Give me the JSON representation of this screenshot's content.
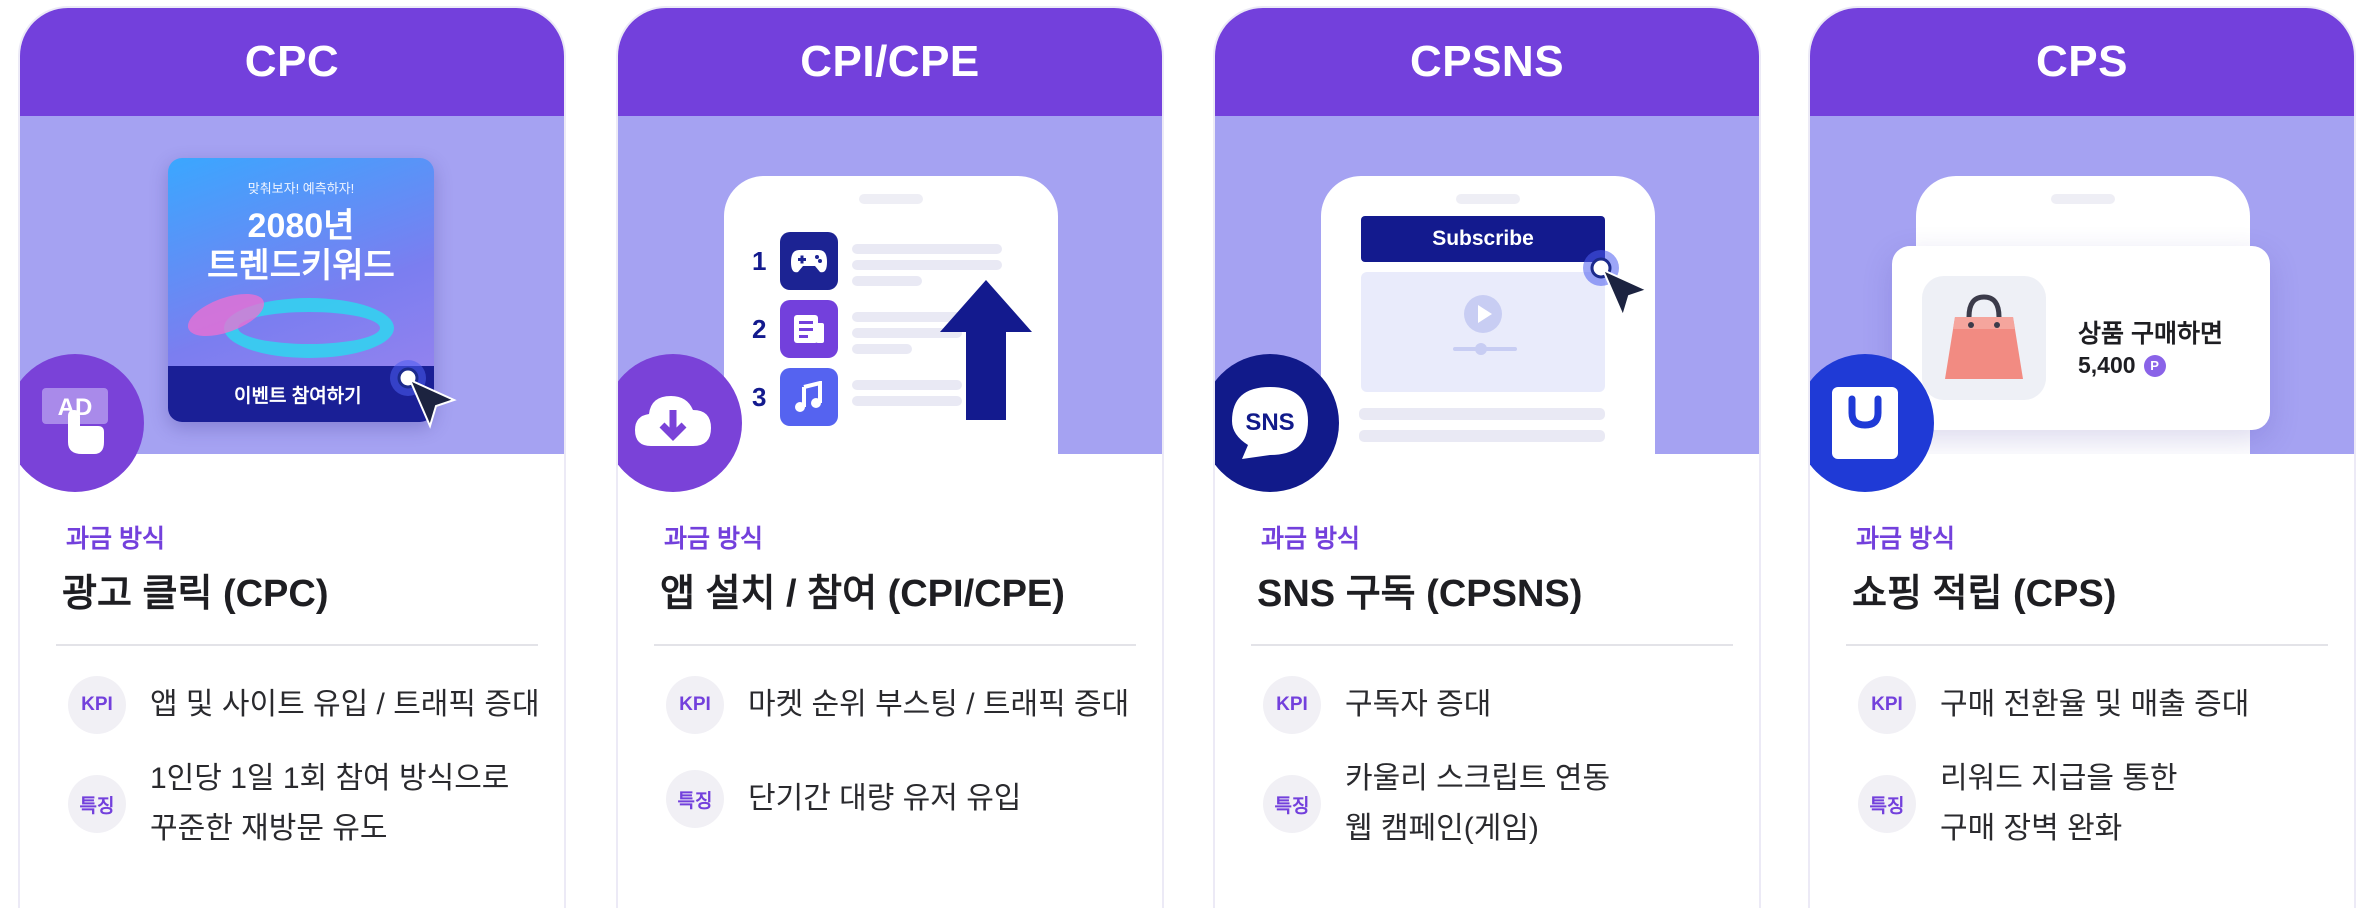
{
  "common": {
    "billing_label": "과금 방식",
    "kpi_tag": "KPI",
    "feature_tag": "특징"
  },
  "cards": [
    {
      "header": "CPC",
      "badge_icon": "ad-click-icon",
      "badge_text": "AD",
      "visual": {
        "banner_small": "맞춰보자! 예측하자!",
        "banner_line1": "2080년",
        "banner_line2": "트렌드키워드",
        "banner_button": "이벤트 참여하기"
      },
      "title": "광고 클릭 (CPC)",
      "kpi": "앱 및 사이트 유입 / 트래픽 증대",
      "feature_lines": [
        "1인당 1일 1회 참여 방식으로",
        "꾸준한 재방문 유도"
      ]
    },
    {
      "header": "CPI/CPE",
      "badge_icon": "cloud-download-icon",
      "visual": {
        "ranks": [
          "1",
          "2",
          "3"
        ]
      },
      "title": "앱 설치 / 참여 (CPI/CPE)",
      "kpi": "마켓 순위 부스팅 / 트래픽 증대",
      "feature_lines": [
        "단기간 대량 유저 유입"
      ]
    },
    {
      "header": "CPSNS",
      "badge_icon": "sns-chat-icon",
      "badge_text": "SNS",
      "visual": {
        "subscribe_button": "Subscribe"
      },
      "title": "SNS 구독 (CPSNS)",
      "kpi": "구독자 증대",
      "feature_lines": [
        "카울리 스크립트 연동",
        "웹 캠페인(게임)"
      ]
    },
    {
      "header": "CPS",
      "badge_icon": "shopping-bag-icon",
      "visual": {
        "product_text": "상품 구매하면",
        "reward_amount": "5,400",
        "point_symbol": "P"
      },
      "title": "쇼핑 적립 (CPS)",
      "kpi": "구매 전환율 및 매출 증대",
      "feature_lines": [
        "리워드 지급을 통한",
        "구매 장벽 완화"
      ]
    }
  ],
  "colors": {
    "header": "#7340dc",
    "visual_bg": "#a5a2f2",
    "badge_purple": "#7a42d8",
    "badge_navy": "#111a8a",
    "badge_blue": "#1f3ad6",
    "navy": "#131a8e"
  }
}
